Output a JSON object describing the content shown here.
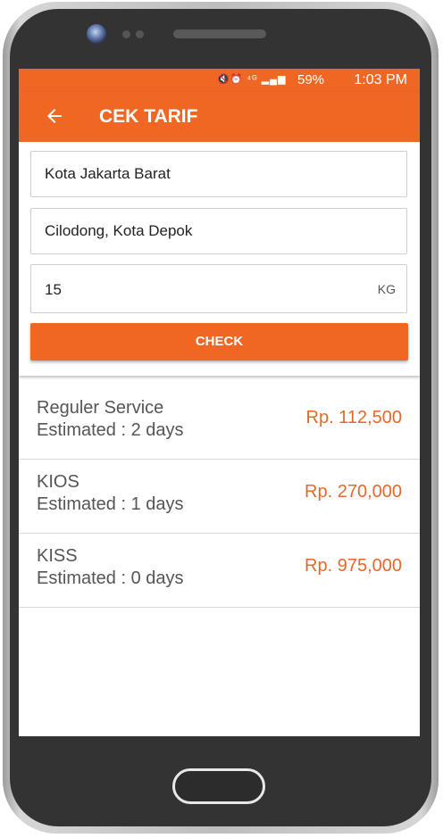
{
  "status_bar": {
    "icons": "🔇⏰ ⁴ᴳ ▂▄▆",
    "battery": "59%",
    "time": "1:03 PM"
  },
  "appbar": {
    "title": "CEK TARIF",
    "back_icon": "arrow-left-icon"
  },
  "form": {
    "origin": "Kota Jakarta Barat",
    "destination": "Cilodong, Kota Depok",
    "weight": "15",
    "weight_unit": "KG",
    "check_label": "CHECK"
  },
  "results": [
    {
      "service": "Reguler Service",
      "estimate": "Estimated : 2 days",
      "price": "Rp. 112,500"
    },
    {
      "service": "KIOS",
      "estimate": "Estimated : 1 days",
      "price": "Rp. 270,000"
    },
    {
      "service": "KISS",
      "estimate": "Estimated : 0 days",
      "price": "Rp. 975,000"
    }
  ],
  "colors": {
    "accent": "#f06723",
    "price": "#e8672a",
    "frame": "#333333"
  }
}
